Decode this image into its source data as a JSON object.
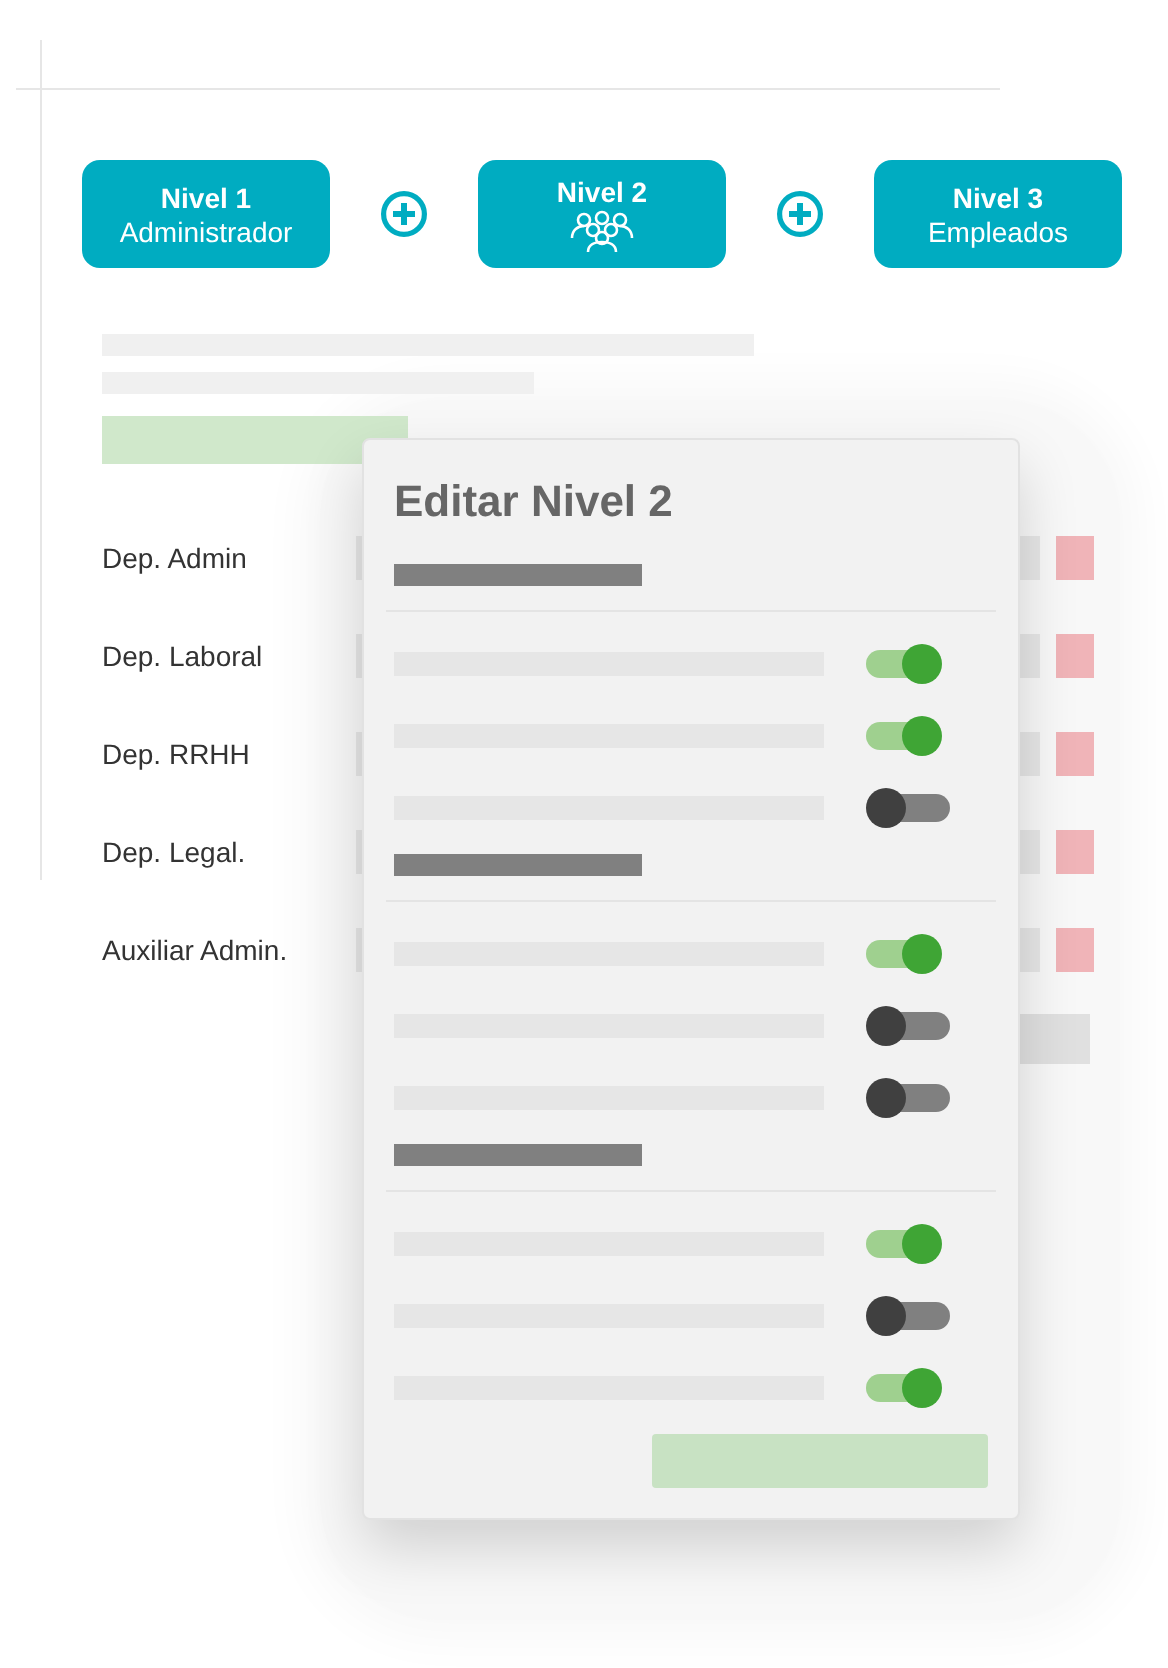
{
  "levels": [
    {
      "kind": "text",
      "title": "Nivel 1",
      "subtitle": "Administrador"
    },
    {
      "kind": "icon",
      "title": "Nivel 2"
    },
    {
      "kind": "text",
      "title": "Nivel 3",
      "subtitle": "Empleados"
    }
  ],
  "departments": [
    "Dep. Admin",
    "Dep. Laboral",
    "Dep. RRHH",
    "Dep. Legal.",
    "Auxiliar Admin."
  ],
  "modal": {
    "title": "Editar Nivel 2",
    "sections": [
      {
        "toggles": [
          {
            "on": true
          },
          {
            "on": true
          },
          {
            "on": false
          }
        ]
      },
      {
        "toggles": [
          {
            "on": true
          },
          {
            "on": false
          },
          {
            "on": false
          }
        ]
      },
      {
        "toggles": [
          {
            "on": true
          },
          {
            "on": false
          },
          {
            "on": true
          }
        ]
      }
    ]
  }
}
